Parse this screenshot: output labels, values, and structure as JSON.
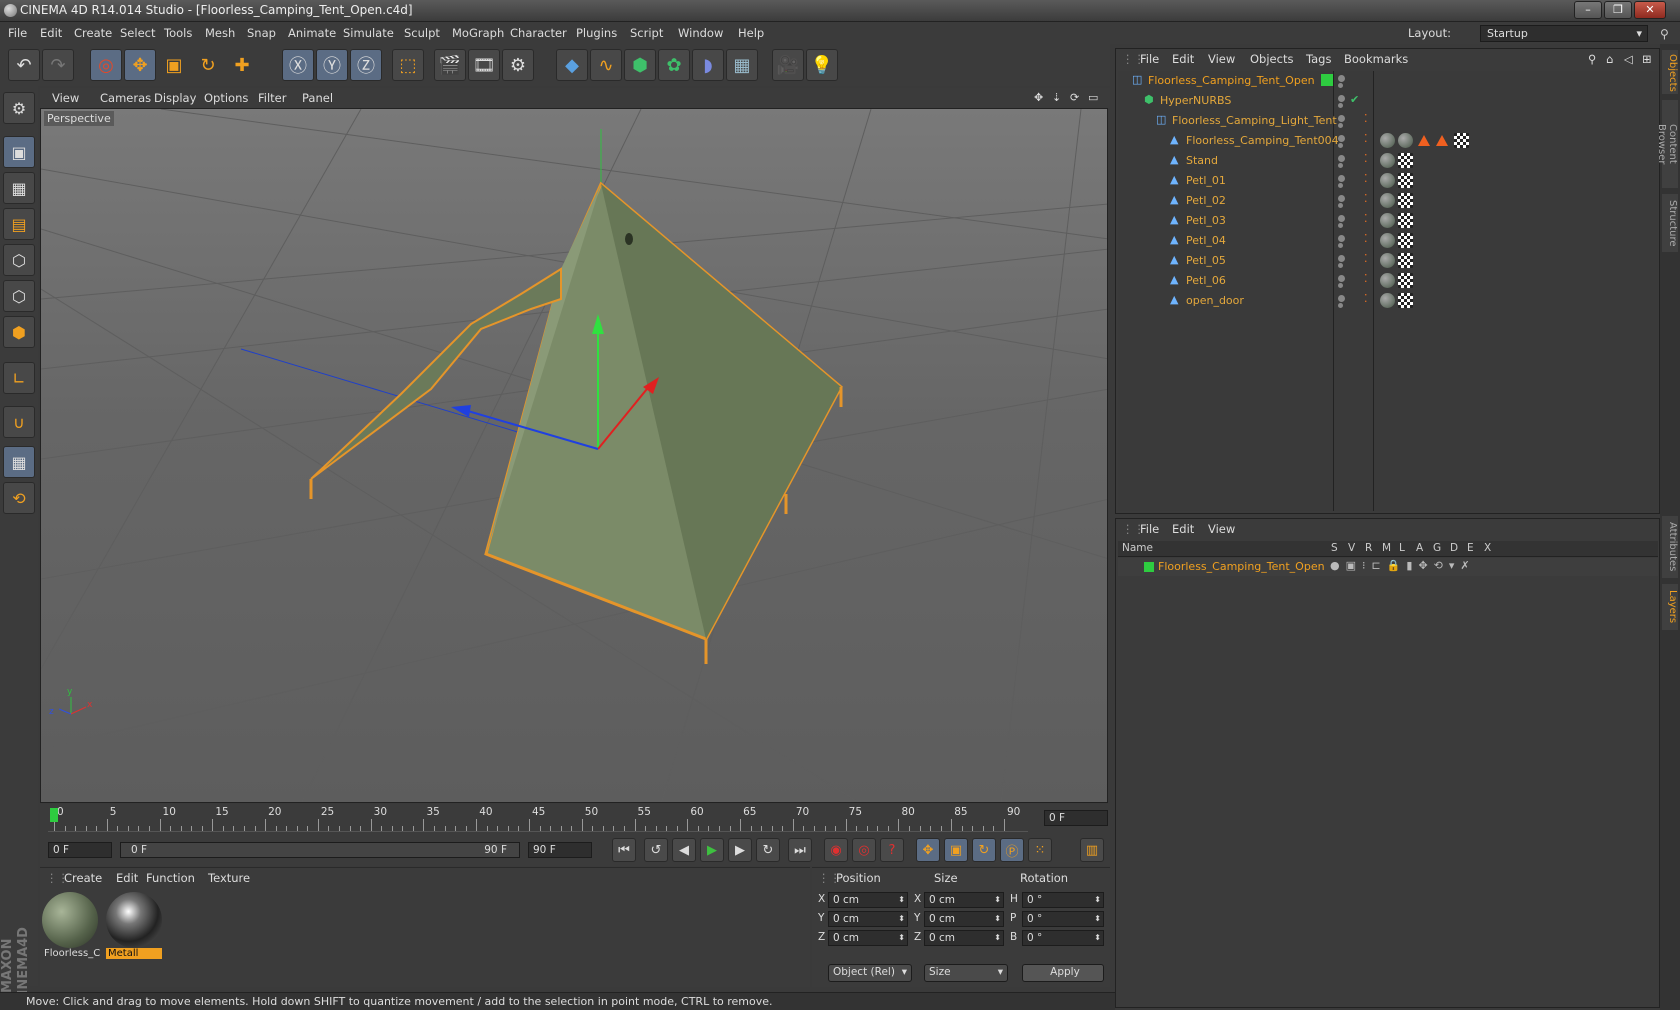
{
  "window": {
    "title": "CINEMA 4D R14.014 Studio - [Floorless_Camping_Tent_Open.c4d]"
  },
  "menu": [
    "File",
    "Edit",
    "Create",
    "Select",
    "Tools",
    "Mesh",
    "Snap",
    "Animate",
    "Simulate",
    "Sculpt",
    "MoGraph",
    "Character",
    "Plugins",
    "Script",
    "Window",
    "Help"
  ],
  "layout": {
    "label": "Layout:",
    "value": "Startup"
  },
  "viewport": {
    "menu": [
      "View",
      "Cameras",
      "Display",
      "Options",
      "Filter",
      "Panel"
    ],
    "label": "Perspective"
  },
  "timeline": {
    "ticks": [
      "0",
      "5",
      "10",
      "15",
      "20",
      "25",
      "30",
      "35",
      "40",
      "45",
      "50",
      "55",
      "60",
      "65",
      "70",
      "75",
      "80",
      "85",
      "90"
    ],
    "current_frame": "0 F",
    "start_field": "0 F",
    "range_start": "0 F",
    "range_end": "90 F",
    "end_field": "90 F"
  },
  "material_manager": {
    "menu": [
      "Create",
      "Edit",
      "Function",
      "Texture"
    ],
    "materials": [
      {
        "name": "Floorless_C",
        "selected": false
      },
      {
        "name": "Metall",
        "selected": true
      }
    ]
  },
  "coordinates": {
    "headers": [
      "Position",
      "Size",
      "Rotation"
    ],
    "rows": [
      {
        "axis": "X",
        "pos": "0 cm",
        "size_axis": "X",
        "size": "0 cm",
        "rot_axis": "H",
        "rot": "0 °"
      },
      {
        "axis": "Y",
        "pos": "0 cm",
        "size_axis": "Y",
        "size": "0 cm",
        "rot_axis": "P",
        "rot": "0 °"
      },
      {
        "axis": "Z",
        "pos": "0 cm",
        "size_axis": "Z",
        "size": "0 cm",
        "rot_axis": "B",
        "rot": "0 °"
      }
    ],
    "mode": "Object (Rel)",
    "size_mode": "Size",
    "apply": "Apply"
  },
  "status": "Move: Click and drag to move elements. Hold down SHIFT to quantize movement / add to the selection in point mode, CTRL to remove.",
  "object_manager": {
    "menu": [
      "File",
      "Edit",
      "View",
      "Objects",
      "Tags",
      "Bookmarks"
    ],
    "objects": [
      {
        "name": "Floorless_Camping_Tent_Open",
        "level": 0
      },
      {
        "name": "HyperNURBS",
        "level": 1
      },
      {
        "name": "Floorless_Camping_Light_Tent",
        "level": 2
      },
      {
        "name": "Floorless_Camping_Tent004",
        "level": 3
      },
      {
        "name": "Stand",
        "level": 3
      },
      {
        "name": "Petl_01",
        "level": 3
      },
      {
        "name": "Petl_02",
        "level": 3
      },
      {
        "name": "Petl_03",
        "level": 3
      },
      {
        "name": "Petl_04",
        "level": 3
      },
      {
        "name": "Petl_05",
        "level": 3
      },
      {
        "name": "Petl_06",
        "level": 3
      },
      {
        "name": "open_door",
        "level": 3
      }
    ]
  },
  "layer_manager": {
    "menu": [
      "File",
      "Edit",
      "View"
    ],
    "columns": [
      "Name",
      "S",
      "V",
      "R",
      "M",
      "L",
      "A",
      "G",
      "D",
      "E",
      "X"
    ],
    "layers": [
      {
        "name": "Floorless_Camping_Tent_Open",
        "color": "#2ecc40"
      }
    ]
  },
  "side_tabs": [
    "Objects",
    "Content Browser",
    "Structure",
    "Attributes",
    "Layers"
  ],
  "colors": {
    "accent": "#f0a020",
    "selection": "#5b6c84",
    "layer_green": "#2ecc40"
  },
  "icons": [
    "undo-icon",
    "redo-icon",
    "select-icon",
    "move-icon",
    "scale-icon",
    "rotate-icon",
    "add-icon",
    "x-axis-icon",
    "y-axis-icon",
    "z-axis-icon",
    "world-coords-icon",
    "render-view-icon",
    "render-picture-icon",
    "render-settings-icon",
    "cube-icon",
    "spline-icon",
    "nurbs-icon",
    "array-icon",
    "deformer-icon",
    "floor-icon",
    "camera-icon",
    "light-icon"
  ]
}
